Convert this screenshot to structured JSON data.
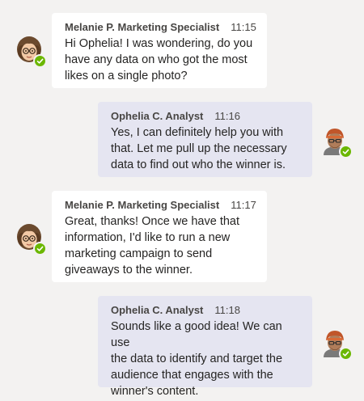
{
  "messages": [
    {
      "sender": "Melanie P. Marketing Specialist",
      "time": "11:15",
      "lines": [
        "Hi Ophelia! I was wondering, do you",
        "have any data on who got the most",
        "likes on a single photo?"
      ]
    },
    {
      "sender": "Ophelia C. Analyst",
      "time": "11:16",
      "lines": [
        "Yes, I can definitely help you with",
        "that. Let me pull up the necessary",
        "data to find out who the winner is."
      ]
    },
    {
      "sender": "Melanie P. Marketing Specialist",
      "time": "11:17",
      "lines": [
        "Great, thanks! Once we have that",
        "information, I'd like to run a new",
        "marketing campaign to send",
        "giveaways to the winner."
      ]
    },
    {
      "sender": "Ophelia C. Analyst",
      "time": "11:18",
      "lines": [
        "Sounds like a good idea! We can use",
        "the data to identify and target the",
        "audience that engages with the",
        "winner's content."
      ]
    }
  ],
  "avatars": {
    "melanie": {
      "icon": "avatar-melanie-icon",
      "presence": "available"
    },
    "ophelia": {
      "icon": "avatar-ophelia-icon",
      "presence": "available"
    }
  },
  "colors": {
    "background": "#f3f2f1",
    "incoming_bubble": "#ffffff",
    "outgoing_bubble": "#e5e5f1",
    "presence_available": "#6bb700"
  }
}
